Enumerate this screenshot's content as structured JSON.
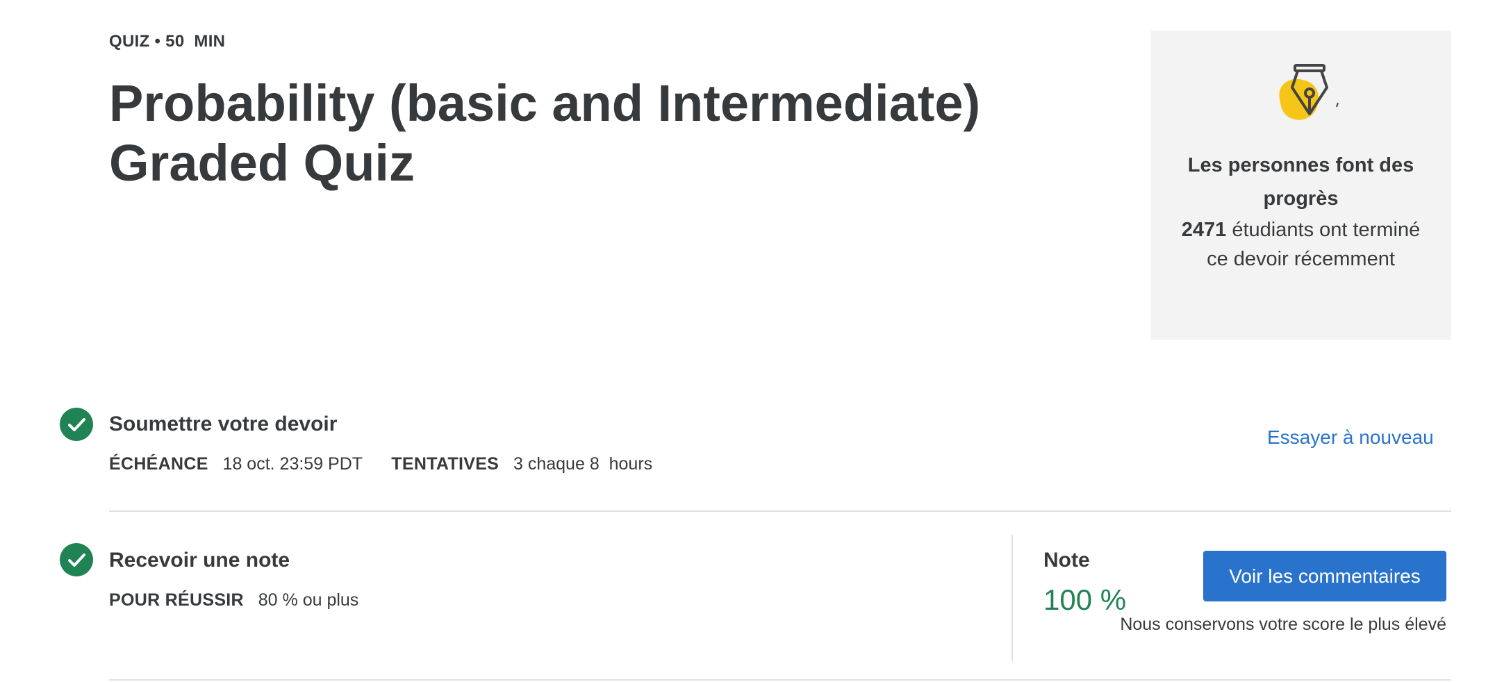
{
  "header": {
    "meta": "QUIZ • 50  MIN",
    "title": "Probability (basic and Intermediate) Graded Quiz"
  },
  "progress_card": {
    "icon": "pen-nib-icon",
    "heading": "Les personnes font des progrès",
    "count": "2471",
    "body_rest": " étudiants ont terminé ce devoir récemment"
  },
  "submit_step": {
    "icon": "check-circle-icon",
    "title": "Soumettre votre devoir",
    "due_label": "ÉCHÉANCE",
    "due_value": "18 oct. 23:59 PDT",
    "attempts_label": "TENTATIVES",
    "attempts_value": "3 chaque 8  hours",
    "retry_label": "Essayer à nouveau"
  },
  "grade_step": {
    "icon": "check-circle-icon",
    "title": "Recevoir une note",
    "pass_label": "POUR RÉUSSIR",
    "pass_value": "80 % ou plus",
    "grade_label": "Note",
    "grade_value": "100 %",
    "feedback_button": "Voir les commentaires",
    "score_note": "Nous conservons votre score le plus élevé"
  },
  "colors": {
    "accent_blue": "#2a73cc",
    "success_green": "#1f8354",
    "pen_yellow": "#f5c518",
    "text_dark": "#373a3c",
    "card_bg": "#f3f3f3"
  }
}
